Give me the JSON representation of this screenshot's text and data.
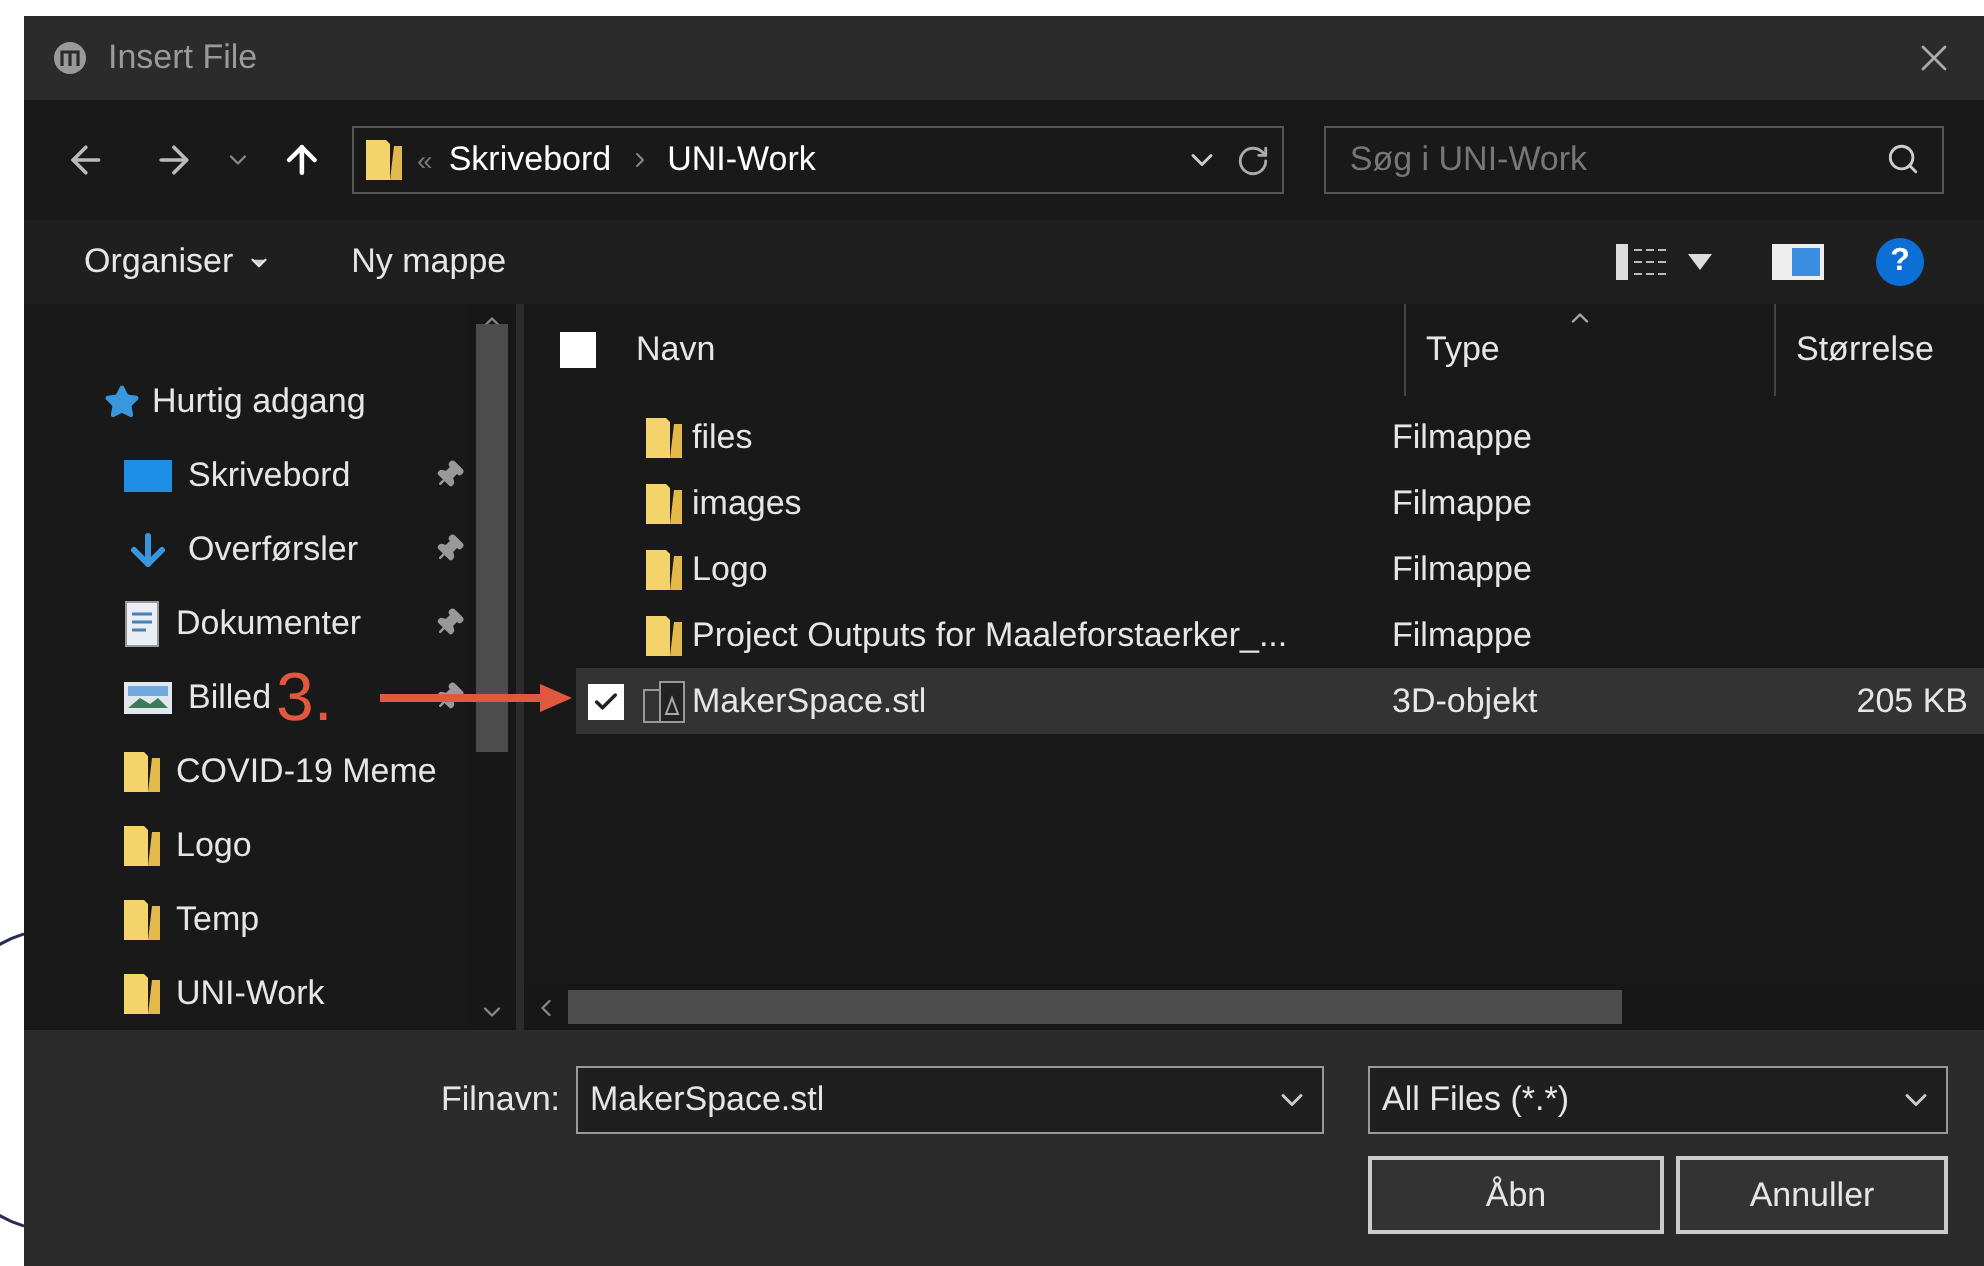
{
  "window": {
    "title": "Insert File"
  },
  "address_bar": {
    "overflow": "«",
    "path": [
      "Skrivebord",
      "UNI-Work"
    ]
  },
  "search": {
    "placeholder": "Søg i UNI-Work"
  },
  "toolbar": {
    "organise": "Organiser",
    "new_folder": "Ny mappe"
  },
  "help": {
    "text": "?"
  },
  "sidebar": {
    "items": [
      {
        "label": "Hurtig adgang",
        "kind": "star",
        "children": [
          {
            "label": "Skrivebord",
            "kind": "desktop",
            "pinned": true
          },
          {
            "label": "Overførsler",
            "kind": "download",
            "pinned": true
          },
          {
            "label": "Dokumenter",
            "kind": "document",
            "pinned": true
          },
          {
            "label": "Billed",
            "kind": "pictures",
            "pinned": true
          },
          {
            "label": "COVID-19 Meme",
            "kind": "folder",
            "pinned": false
          },
          {
            "label": "Logo",
            "kind": "folder",
            "pinned": false
          },
          {
            "label": "Temp",
            "kind": "folder",
            "pinned": false
          },
          {
            "label": "UNI-Work",
            "kind": "folder",
            "pinned": false
          }
        ]
      }
    ]
  },
  "file_list": {
    "select_all": {
      "checked": false
    },
    "columns": [
      {
        "label": "Navn",
        "sorted": false
      },
      {
        "label": "Type",
        "sorted": true
      },
      {
        "label": "Størrelse",
        "sorted": false
      }
    ],
    "rows": [
      {
        "name": "files",
        "type": "Filmappe",
        "kind": "folder",
        "selected": false,
        "checked": false
      },
      {
        "name": "images",
        "type": "Filmappe",
        "kind": "folder",
        "selected": false,
        "checked": false
      },
      {
        "name": "Logo",
        "type": "Filmappe",
        "kind": "folder",
        "selected": false,
        "checked": false
      },
      {
        "name": "Project Outputs for Maaleforstaerker_...",
        "type": "Filmappe",
        "kind": "folder",
        "selected": false,
        "checked": false
      },
      {
        "name": "MakerSpace.stl",
        "type": "3D-objekt",
        "size": "205 KB",
        "kind": "model",
        "selected": true,
        "checked": true
      }
    ]
  },
  "annotation": {
    "text": "3.",
    "color": "#e0583f"
  },
  "filename": {
    "label": "Filnavn:",
    "value": "MakerSpace.stl"
  },
  "filter": {
    "value": "All Files (*.*)"
  },
  "buttons": [
    "Åbn",
    "Annuller"
  ]
}
